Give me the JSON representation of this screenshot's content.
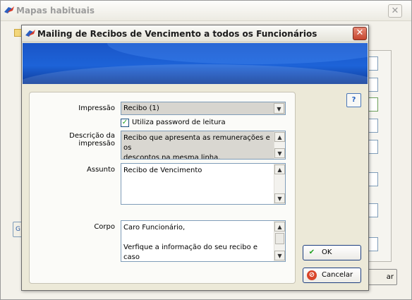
{
  "parent_window": {
    "title": "Mapas habituais",
    "cancel_partial_label": "ar"
  },
  "dialog": {
    "title": "Mailing de Recibos de Vencimento a todos os Funcionários",
    "close_label": "✕",
    "help_label": "?"
  },
  "form": {
    "impressao_label": "Impressão",
    "impressao_value": "Recibo  (1)",
    "checkbox_label": "Utiliza password de leitura",
    "checkbox_checked": true,
    "descricao_label": "Descrição da impressão",
    "descricao_value": "Recibo que apresenta as remunerações e os\ndescontos na mesma linha.",
    "assunto_label": "Assunto",
    "assunto_value": "Recibo de Vencimento",
    "corpo_label": "Corpo",
    "corpo_value": "Caro Funcionário,\n\nVerfique a informação do seu recibo e caso\ntenha duvidas contacte o dep. de Pessoal."
  },
  "buttons": {
    "ok_label": "OK",
    "cancel_label": "Cancelar"
  },
  "icons": {
    "app": "app-logo-icon",
    "ok": "checkmark-icon",
    "cancel": "cancel-icon",
    "help": "help-icon",
    "combo": "chevron-down-icon"
  }
}
